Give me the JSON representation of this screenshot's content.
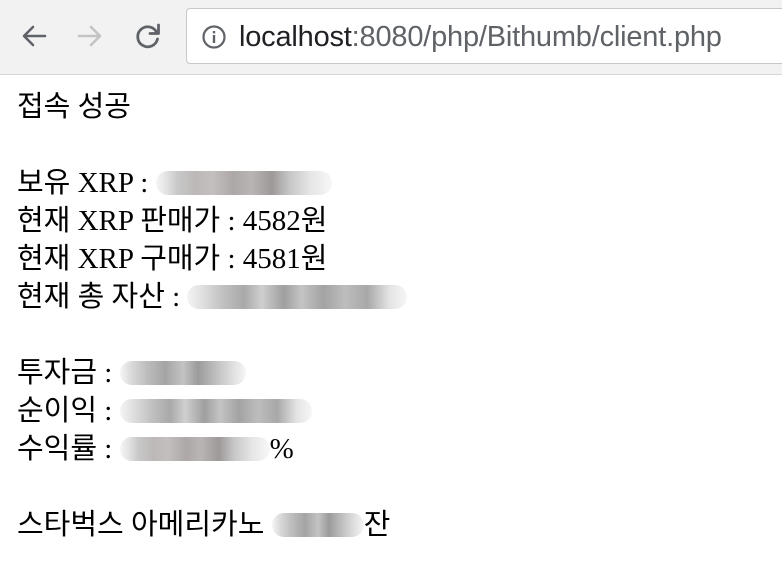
{
  "browser": {
    "url_host": "localhost",
    "url_path": ":8080/php/Bithumb/client.php",
    "back_icon": "arrow-left-icon",
    "forward_icon": "arrow-right-icon",
    "reload_icon": "reload-icon",
    "info_icon": "info-circle-icon"
  },
  "page": {
    "status": "접속 성공",
    "holding_label": "보유 XRP : ",
    "sell_price": "현재 XRP 판매가 : 4582원",
    "buy_price": "현재 XRP 구매가 : 4581원",
    "total_assets_label": "현재 총 자산 : ",
    "investment_label": "투자금 : ",
    "net_profit_label": "순이익 : ",
    "return_rate_label": "수익률 : ",
    "return_rate_suffix": "%",
    "starbucks_label": "스타벅스 아메리카노 ",
    "starbucks_suffix": "잔"
  }
}
